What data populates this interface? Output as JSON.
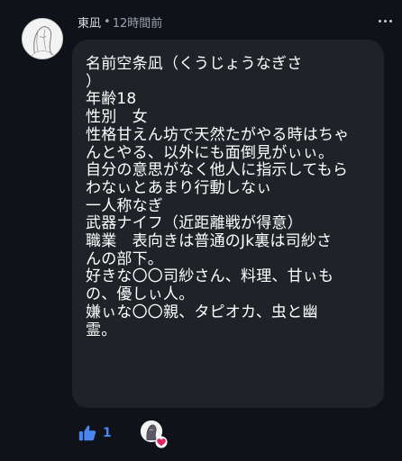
{
  "comment": {
    "author": "東凪",
    "separator": "•",
    "time": "12時間前",
    "lines": [
      "名前空条凪（くうじょうなぎさ",
      "）",
      "年齢18",
      "性別　女",
      "性格甘えん坊で天然たがやる時はちゃ",
      "んとやる、以外にも面倒見がぃぃ。",
      "自分の意思がなく他人に指示してもら",
      "わなぃとあまり行動しなぃ",
      "一人称なぎ",
      "武器ナイフ（近距離戦が得意）",
      "職業　表向きは普通のJk裏は司紗さ",
      "んの部下。",
      "好きな〇〇司紗さん、料理、甘ぃも",
      "の、優しぃ人。",
      "嫌ぃな〇〇親、タピオカ、虫と幽",
      "霊。"
    ]
  },
  "reactions": {
    "like_count": "1",
    "like_color": "#4b86f0",
    "heart_color": "#e0245e"
  },
  "icons": {
    "menu": "more-dots-icon",
    "like": "thumbs-up-icon",
    "heart": "heart-icon"
  }
}
